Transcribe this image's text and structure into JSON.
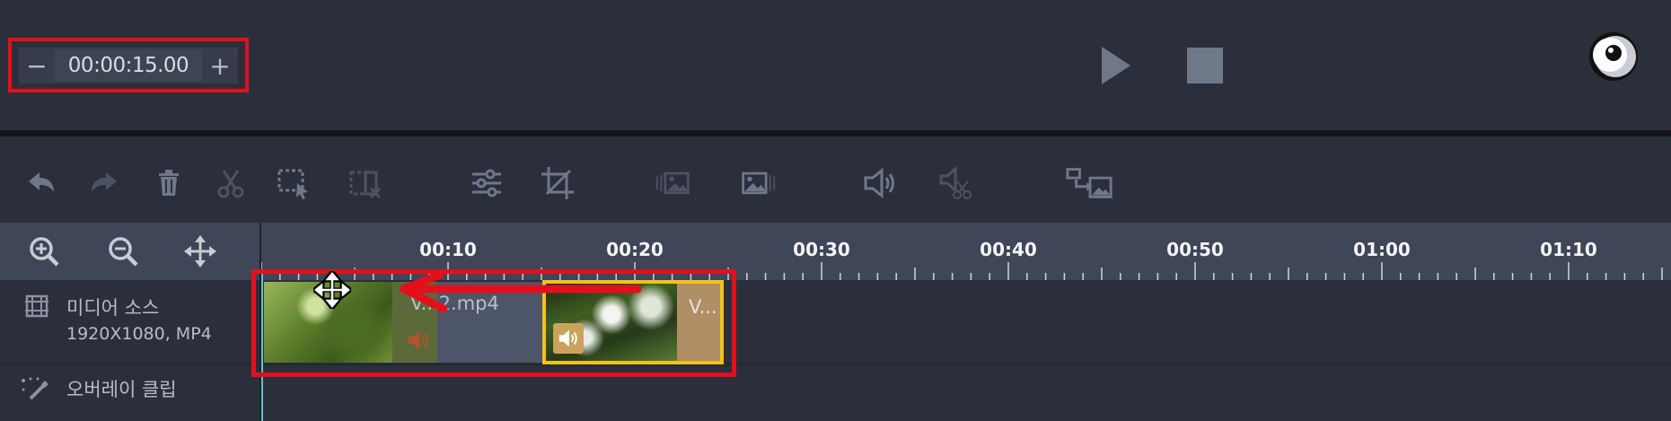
{
  "transport": {
    "decrement_label": "−",
    "duration_value": "00:00:15.00",
    "increment_label": "+",
    "play_icon": "play-icon",
    "stop_icon": "stop-icon"
  },
  "toolbar": {
    "icons": [
      "undo-icon",
      "redo-icon",
      "delete-icon",
      "cut-icon",
      "select-range-icon",
      "split-delete-icon",
      "adjust-icon",
      "crop-icon",
      "fade-in-image-icon",
      "fade-out-image-icon",
      "volume-icon",
      "mute-cut-icon",
      "replace-media-icon"
    ]
  },
  "timeline": {
    "zoom_icons": [
      "zoom-in-icon",
      "zoom-out-icon",
      "fit-move-icon"
    ],
    "ruler_labels": [
      "00:10",
      "00:20",
      "00:30",
      "00:40",
      "00:50",
      "01:00",
      "01:10"
    ]
  },
  "tracks": {
    "media": {
      "title": "미디어 소스",
      "subtitle": "1920X1080, MP4"
    },
    "overlay": {
      "title": "오버레이 클립"
    }
  },
  "clips": {
    "clip1_name": "V...2.mp4",
    "clip2_name": "V..."
  },
  "colors": {
    "annotation": "#e3101c",
    "selected_clip_border": "#f1c21b",
    "playhead": "#5ec4c8"
  }
}
